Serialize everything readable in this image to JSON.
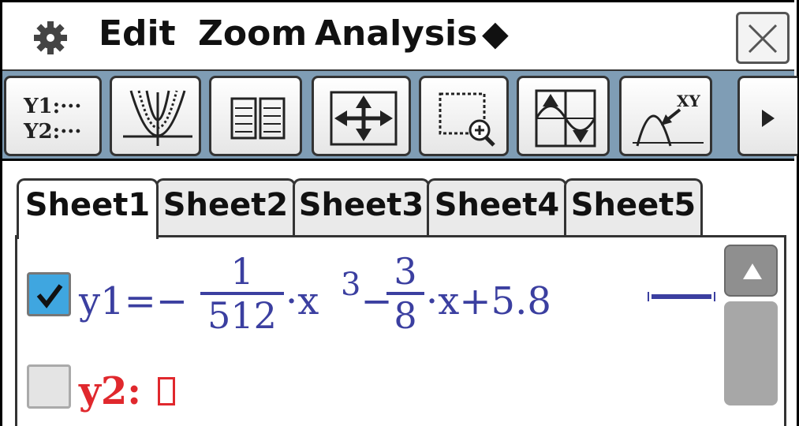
{
  "menu": {
    "icon": "gear-icon",
    "items": [
      "Edit",
      "Zoom",
      "Analysis",
      "◆"
    ],
    "close_icon": "close-icon"
  },
  "toolbar": {
    "buttons": [
      {
        "name": "graph-editor-button",
        "icon": "y1-y2-list-icon",
        "line1": "Y1:···",
        "line2": "Y2:···"
      },
      {
        "name": "graph-window-button",
        "icon": "graph-family-icon"
      },
      {
        "name": "table-button",
        "icon": "table-icon"
      },
      {
        "name": "pan-button",
        "icon": "four-arrows-icon"
      },
      {
        "name": "zoom-box-button",
        "icon": "zoom-box-icon"
      },
      {
        "name": "resize-button",
        "icon": "arrows-curve-icon"
      },
      {
        "name": "trace-button",
        "icon": "trace-xy-icon",
        "label": "XY"
      },
      {
        "name": "more-button",
        "icon": "play-right-icon"
      }
    ]
  },
  "sheets": {
    "tabs": [
      "Sheet1",
      "Sheet2",
      "Sheet3",
      "Sheet4",
      "Sheet5"
    ],
    "active": "Sheet1"
  },
  "equations": [
    {
      "checked": true,
      "lhs": "y1=−",
      "frac1_num": "1",
      "frac1_den": "512",
      "mid": "·x",
      "exponent": "3",
      "minus": "−",
      "frac2_num": "3",
      "frac2_den": "8",
      "tail": "·x+5.8",
      "color": "#3b3fa0",
      "style": "thick-line"
    },
    {
      "checked": false,
      "label": "y2:",
      "color": "#e0282d"
    }
  ],
  "colors": {
    "toolbar_bg": "#7f9db5",
    "checkbox_checked": "#3fa6e0",
    "scroll_button": "#8f8f8f"
  }
}
